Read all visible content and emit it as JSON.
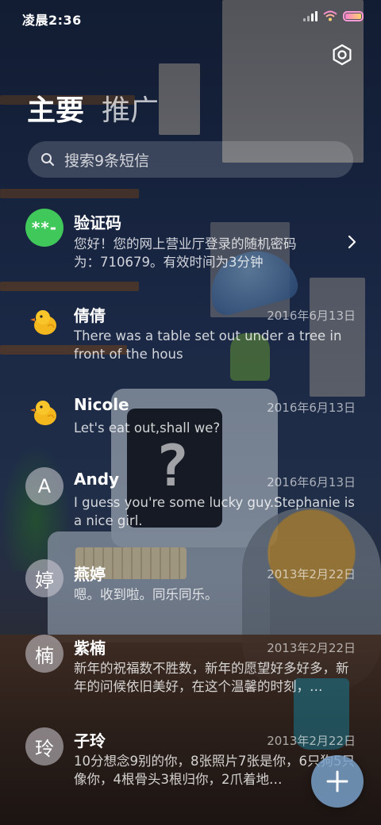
{
  "status_bar": {
    "time": "凌晨2:36",
    "icons": [
      "signal-icon",
      "wifi-icon",
      "battery-icon"
    ]
  },
  "header": {
    "settings_icon": "gear-icon",
    "tabs": [
      {
        "label": "主要",
        "active": true
      },
      {
        "label": "推广",
        "active": false
      }
    ]
  },
  "search": {
    "icon": "search-icon",
    "placeholder": "搜索9条短信"
  },
  "conversations": [
    {
      "avatar_type": "code",
      "avatar_text": "**-",
      "sender": "验证码",
      "date": "",
      "preview": "您好！您的网上营业厅登录的随机密码为：710679。有效时间为3分钟",
      "has_chevron": true
    },
    {
      "avatar_type": "chick",
      "avatar_text": "",
      "sender": "倩倩",
      "date": "2016年6月13日",
      "preview": "There was a table set out under a tree in front of the hous",
      "has_chevron": false
    },
    {
      "avatar_type": "chick",
      "avatar_text": "",
      "sender": "Nicole",
      "date": "2016年6月13日",
      "preview": "Let's eat out,shall we?",
      "has_chevron": false
    },
    {
      "avatar_type": "letter",
      "avatar_text": "A",
      "sender": "Andy",
      "date": "2016年6月13日",
      "preview": "I guess you're some lucky guy.Stephanie is a nice girl.",
      "has_chevron": false
    },
    {
      "avatar_type": "letter",
      "avatar_text": "婷",
      "sender": "燕婷",
      "date": "2013年2月22日",
      "preview": "嗯。收到啦。同乐同乐。",
      "has_chevron": false
    },
    {
      "avatar_type": "letter",
      "avatar_text": "楠",
      "sender": "紫楠",
      "date": "2013年2月22日",
      "preview": "新年的祝福数不胜数，新年的愿望好多好多，新年的问候依旧美好，在这个温馨的时刻，…",
      "has_chevron": false
    },
    {
      "avatar_type": "letter",
      "avatar_text": "玲",
      "sender": "子玲",
      "date": "2013年2月22日",
      "preview": "10分想念9别的你，8张照片7张是你，6只狗5只像你，4根骨头3根归你，2爪着地…",
      "has_chevron": false
    }
  ],
  "fab": {
    "icon": "plus-icon"
  },
  "colors": {
    "code_avatar": "#40c85a",
    "battery": "#ff7fd0"
  }
}
